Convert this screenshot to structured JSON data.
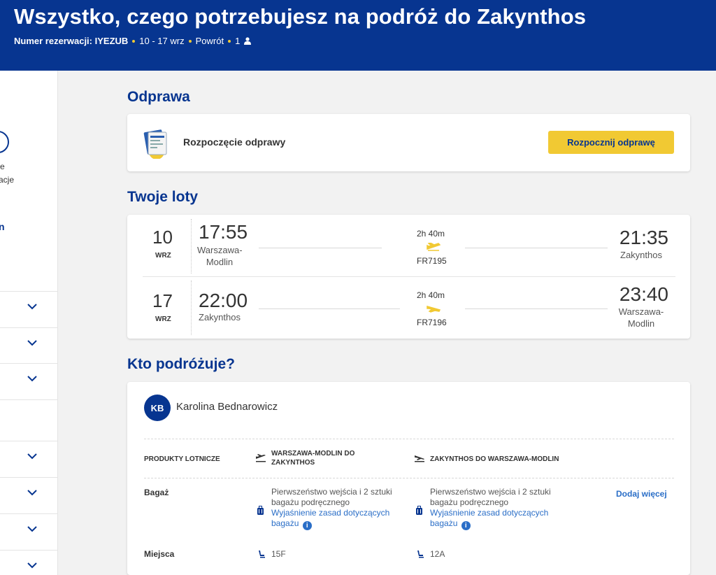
{
  "header": {
    "title": "Wszystko, czego potrzebujesz na podróż do Zakynthos",
    "booking_label": "Numer rezerwacji:",
    "booking_ref": "IYEZUB",
    "dates": "10 - 17 wrz",
    "trip_type": "Powrót",
    "passengers": "1",
    "accent": "#073590",
    "dot_color": "#f1c933"
  },
  "sidebar": {
    "text_line1": "e",
    "text_line2": "acje",
    "link_text": "n"
  },
  "checkin": {
    "section_title": "Odprawa",
    "label": "Rozpoczęcie odprawy",
    "button_label": "Rozpocznij odprawę"
  },
  "flights": {
    "section_title": "Twoje loty",
    "items": [
      {
        "day": "10",
        "month": "WRZ",
        "dep_time": "17:55",
        "dep_place": "Warszawa-Modlin",
        "duration": "2h 40m",
        "flight_no": "FR7195",
        "arr_time": "21:35",
        "arr_place": "Zakynthos"
      },
      {
        "day": "17",
        "month": "WRZ",
        "dep_time": "22:00",
        "dep_place": "Zakynthos",
        "duration": "2h 40m",
        "flight_no": "FR7196",
        "arr_time": "23:40",
        "arr_place": "Warszawa-Modlin"
      }
    ]
  },
  "passengers": {
    "section_title": "Kto podróżuje?",
    "initials": "KB",
    "name": "Karolina Bednarowicz",
    "col_products": "PRODUKTY LOTNICZE",
    "col_outbound": "WARSZAWA-MODLIN DO ZAKYNTHOS",
    "col_return": "ZAKYNTHOS DO WARSZAWA-MODLIN",
    "baggage_label": "Bagaż",
    "baggage_text": "Pierwszeństwo wejścia i 2 sztuki bagażu podręcznego",
    "baggage_link": "Wyjaśnienie zasad dotyczących bagażu",
    "add_more": "Dodaj więcej",
    "seats_label": "Miejsca",
    "seat_outbound": "15F",
    "seat_return": "12A"
  }
}
